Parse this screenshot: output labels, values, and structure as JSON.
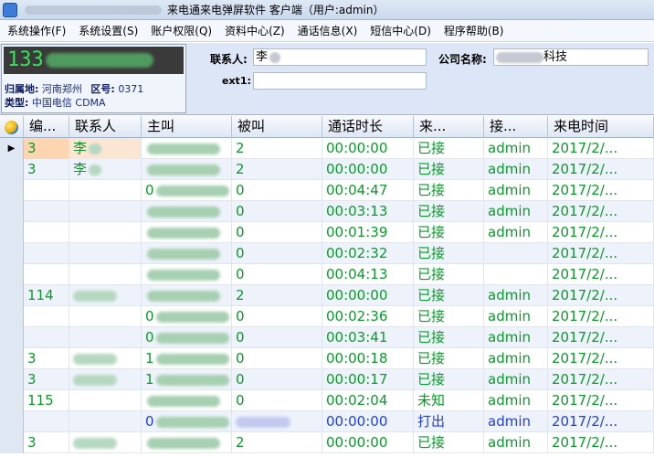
{
  "window": {
    "title": "来电通来电弹屏软件 客户端（用户:admin）"
  },
  "menu": [
    {
      "label": "系统操作(F)"
    },
    {
      "label": "系统设置(S)"
    },
    {
      "label": "账户权限(Q)"
    },
    {
      "label": "资料中心(Z)"
    },
    {
      "label": "通话信息(X)"
    },
    {
      "label": "短信中心(D)"
    },
    {
      "label": "程序帮助(B)"
    }
  ],
  "info": {
    "phone_prefix": "133",
    "location_label": "归属地:",
    "location_value": "河南郑州",
    "area_code_label": "区号:",
    "area_code_value": "0371",
    "type_label": "类型:",
    "type_value": "中国电信 CDMA",
    "contact_label": "联系人:",
    "contact_value": "李",
    "company_label": "公司名称:",
    "company_suffix": "科技",
    "ext_label": "ext1:",
    "ext_value": ""
  },
  "table": {
    "headers": [
      "编...",
      "联系人",
      "主叫",
      "被叫",
      "通话时长",
      "来...",
      "接...",
      "来电时间"
    ],
    "rows": [
      {
        "id": "3",
        "contact": "李",
        "caller_prefix": "",
        "callee": "2",
        "duration": "00:00:00",
        "status": "已接",
        "receiver": "admin",
        "time": "2017/2/...",
        "selected": true
      },
      {
        "id": "3",
        "contact": "李",
        "caller_prefix": "",
        "callee": "2",
        "duration": "00:00:00",
        "status": "已接",
        "receiver": "admin",
        "time": "2017/2/..."
      },
      {
        "id": "",
        "contact": "",
        "caller_prefix": "0",
        "callee": "0",
        "duration": "00:04:47",
        "status": "已接",
        "receiver": "admin",
        "time": "2017/2/..."
      },
      {
        "id": "",
        "contact": "",
        "caller_prefix": "",
        "callee": "0",
        "duration": "00:03:13",
        "status": "已接",
        "receiver": "admin",
        "time": "2017/2/..."
      },
      {
        "id": "",
        "contact": "",
        "caller_prefix": "",
        "callee": "0",
        "duration": "00:01:39",
        "status": "已接",
        "receiver": "admin",
        "time": "2017/2/..."
      },
      {
        "id": "",
        "contact": "",
        "caller_prefix": "",
        "callee": "0",
        "duration": "00:02:32",
        "status": "已接",
        "receiver": "",
        "time": "2017/2/..."
      },
      {
        "id": "",
        "contact": "",
        "caller_prefix": "",
        "callee": "0",
        "duration": "00:04:13",
        "status": "已接",
        "receiver": "",
        "time": "2017/2/..."
      },
      {
        "id": "114",
        "contact": "",
        "caller_prefix": "",
        "callee": "2",
        "duration": "00:00:00",
        "status": "已接",
        "receiver": "admin",
        "time": "2017/2/..."
      },
      {
        "id": "",
        "contact": "",
        "caller_prefix": "0",
        "callee": "0",
        "duration": "00:02:36",
        "status": "已接",
        "receiver": "admin",
        "time": "2017/2/..."
      },
      {
        "id": "",
        "contact": "",
        "caller_prefix": "0",
        "callee": "0",
        "duration": "00:03:41",
        "status": "已接",
        "receiver": "admin",
        "time": "2017/2/..."
      },
      {
        "id": "3",
        "contact": "",
        "caller_prefix": "1",
        "callee": "0",
        "duration": "00:00:18",
        "status": "已接",
        "receiver": "admin",
        "time": "2017/2/..."
      },
      {
        "id": "3",
        "contact": "",
        "caller_prefix": "1",
        "callee": "0",
        "duration": "00:00:17",
        "status": "已接",
        "receiver": "admin",
        "time": "2017/2/..."
      },
      {
        "id": "115",
        "contact": "",
        "caller_prefix": "",
        "callee": "0",
        "duration": "00:02:04",
        "status": "未知",
        "receiver": "admin",
        "time": "2017/2/..."
      },
      {
        "id": "",
        "contact": "",
        "caller_prefix": "0",
        "callee": "",
        "duration": "00:00:00",
        "status": "打出",
        "receiver": "admin",
        "time": "2017/2/...",
        "outgoing": true
      },
      {
        "id": "3",
        "contact": "",
        "caller_prefix": "",
        "callee": "2",
        "duration": "00:00:00",
        "status": "已接",
        "receiver": "admin",
        "time": "2017/2/..."
      }
    ]
  },
  "colors": {
    "answered_text": "#0a9a2a",
    "outgoing_text": "#1f3fe0",
    "phone_display_digits": "#37e05a",
    "selected_row": "#fdd5b0"
  }
}
